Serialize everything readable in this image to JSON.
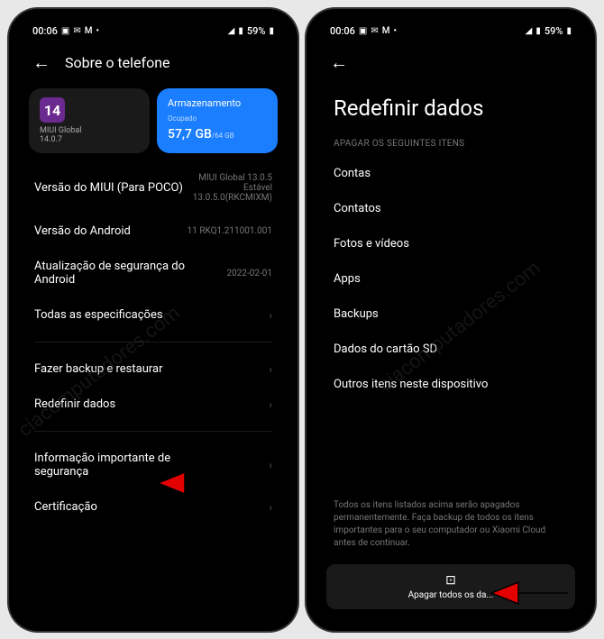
{
  "statusbar": {
    "time": "00:06",
    "battery": "59%"
  },
  "left": {
    "header_title": "Sobre o telefone",
    "miui_card": {
      "version_label": "MIUI Global",
      "version": "14.0.7"
    },
    "storage_card": {
      "title": "Armazenamento",
      "sub": "Ocupado",
      "used": "57,7 GB",
      "total": "/64 GB"
    },
    "items": [
      {
        "label": "Versão do MIUI (Para POCO)",
        "value": "MIUI Global 13.0.5\nEstável\n13.0.5.0(RKCMIXM)"
      },
      {
        "label": "Versão do Android",
        "value": "11 RKQ1.211001.001"
      },
      {
        "label": "Atualização de segurança do Android",
        "value": "2022-02-01"
      },
      {
        "label": "Todas as especificações",
        "value": ""
      }
    ],
    "items2": [
      {
        "label": "Fazer backup e restaurar"
      },
      {
        "label": "Redefinir dados"
      }
    ],
    "items3": [
      {
        "label": "Informação importante de segurança"
      },
      {
        "label": "Certificação"
      }
    ]
  },
  "right": {
    "page_title": "Redefinir dados",
    "section_label": "APAGAR OS SEGUINTES ITENS",
    "data_items": [
      "Contas",
      "Contatos",
      "Fotos e vídeos",
      "Apps",
      "Backups",
      "Dados do cartão SD",
      "Outros itens neste dispositivo"
    ],
    "footer": "Todos os itens listados acima serão apagados permanentemente. Faça backup de todos os itens importantes para o seu computador ou Xiaomi Cloud antes de continuar.",
    "erase_label": "Apagar todos os da..."
  },
  "watermark": "ciacomputadores.com"
}
